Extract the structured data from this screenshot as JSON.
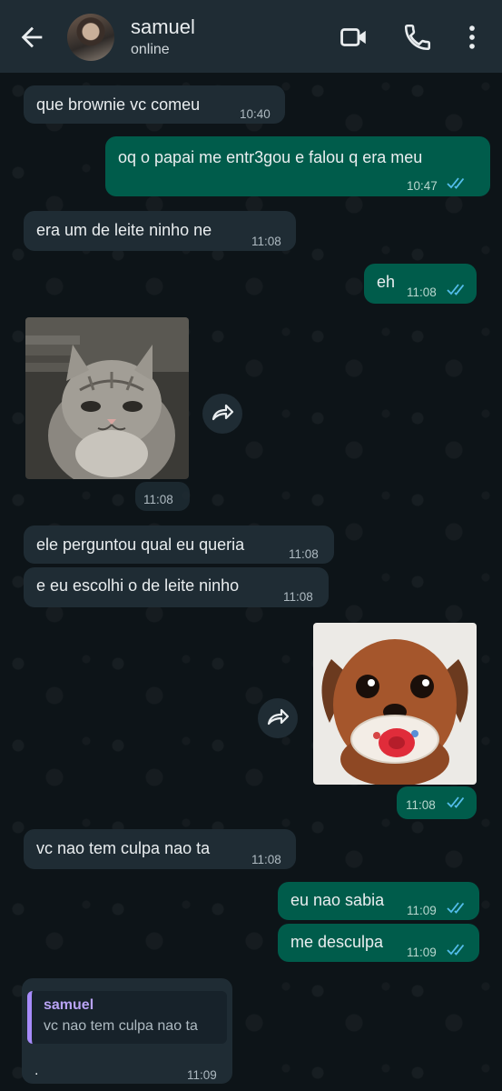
{
  "header": {
    "contact_name": "samuel",
    "status": "online",
    "icons": [
      "back-arrow-icon",
      "avatar",
      "video-call-icon",
      "phone-icon",
      "more-vert-icon"
    ]
  },
  "messages": [
    {
      "dir": "in",
      "text": "que brownie vc comeu",
      "time": "10:40"
    },
    {
      "dir": "out",
      "text": "oq o papai me entr3gou e falou q era meu",
      "time": "10:47",
      "read": true
    },
    {
      "dir": "in",
      "text": "era um de leite ninho ne",
      "time": "11:08"
    },
    {
      "dir": "out",
      "text": "eh",
      "time": "11:08",
      "read": true
    },
    {
      "dir": "in",
      "type": "sticker",
      "description": "cat-sticker",
      "time": "11:08"
    },
    {
      "dir": "in",
      "text": "ele perguntou qual eu queria",
      "time": "11:08"
    },
    {
      "dir": "in",
      "text": "e eu escolhi o de leite ninho",
      "time": "11:08"
    },
    {
      "dir": "out",
      "type": "sticker",
      "description": "puppy-sticker",
      "time": "11:08",
      "read": true
    },
    {
      "dir": "in",
      "text": "vc nao tem culpa nao ta",
      "time": "11:08"
    },
    {
      "dir": "out",
      "text": "eu nao sabia",
      "time": "11:09",
      "read": true
    },
    {
      "dir": "out",
      "text": "me desculpa",
      "time": "11:09",
      "read": true
    },
    {
      "dir": "in",
      "type": "reply",
      "quoted_author": "samuel",
      "quoted_text": "vc nao tem culpa nao ta",
      "text": ".",
      "time": "11:09"
    }
  ],
  "colors": {
    "header_bg": "#1f2c34",
    "incoming_bubble": "#1f2c34",
    "outgoing_bubble": "#005c4b",
    "read_ticks": "#53bdeb",
    "quote_accent": "#a78bfa"
  }
}
